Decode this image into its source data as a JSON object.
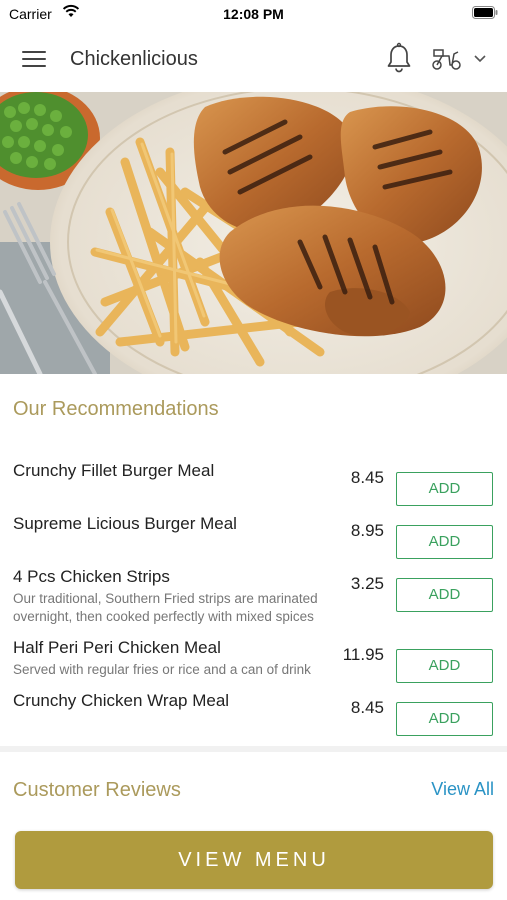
{
  "status_bar": {
    "carrier": "Carrier",
    "time": "12:08 PM"
  },
  "header": {
    "title": "Chickenlicious"
  },
  "recommendations": {
    "title": "Our Recommendations",
    "items": [
      {
        "name": "Crunchy Fillet Burger Meal",
        "description": "",
        "price": "8.45",
        "button": "ADD"
      },
      {
        "name": "Supreme Licious Burger Meal",
        "description": "",
        "price": "8.95",
        "button": "ADD"
      },
      {
        "name": "4 Pcs Chicken Strips",
        "description": "Our traditional, Southern Fried strips are marinated overnight, then cooked perfectly with mixed spices",
        "price": "3.25",
        "button": "ADD"
      },
      {
        "name": "Half Peri Peri Chicken Meal",
        "description": "Served with regular fries or rice and a can of drink",
        "price": "11.95",
        "button": "ADD"
      },
      {
        "name": "Crunchy Chicken Wrap Meal",
        "description": "",
        "price": "8.45",
        "button": "ADD"
      }
    ]
  },
  "reviews": {
    "title": "Customer Reviews",
    "view_all": "View All"
  },
  "footer": {
    "view_menu": "VIEW MENU"
  },
  "colors": {
    "accent_gold": "#b09b3e",
    "add_green": "#3aa15e",
    "link_blue": "#2a93c5"
  }
}
